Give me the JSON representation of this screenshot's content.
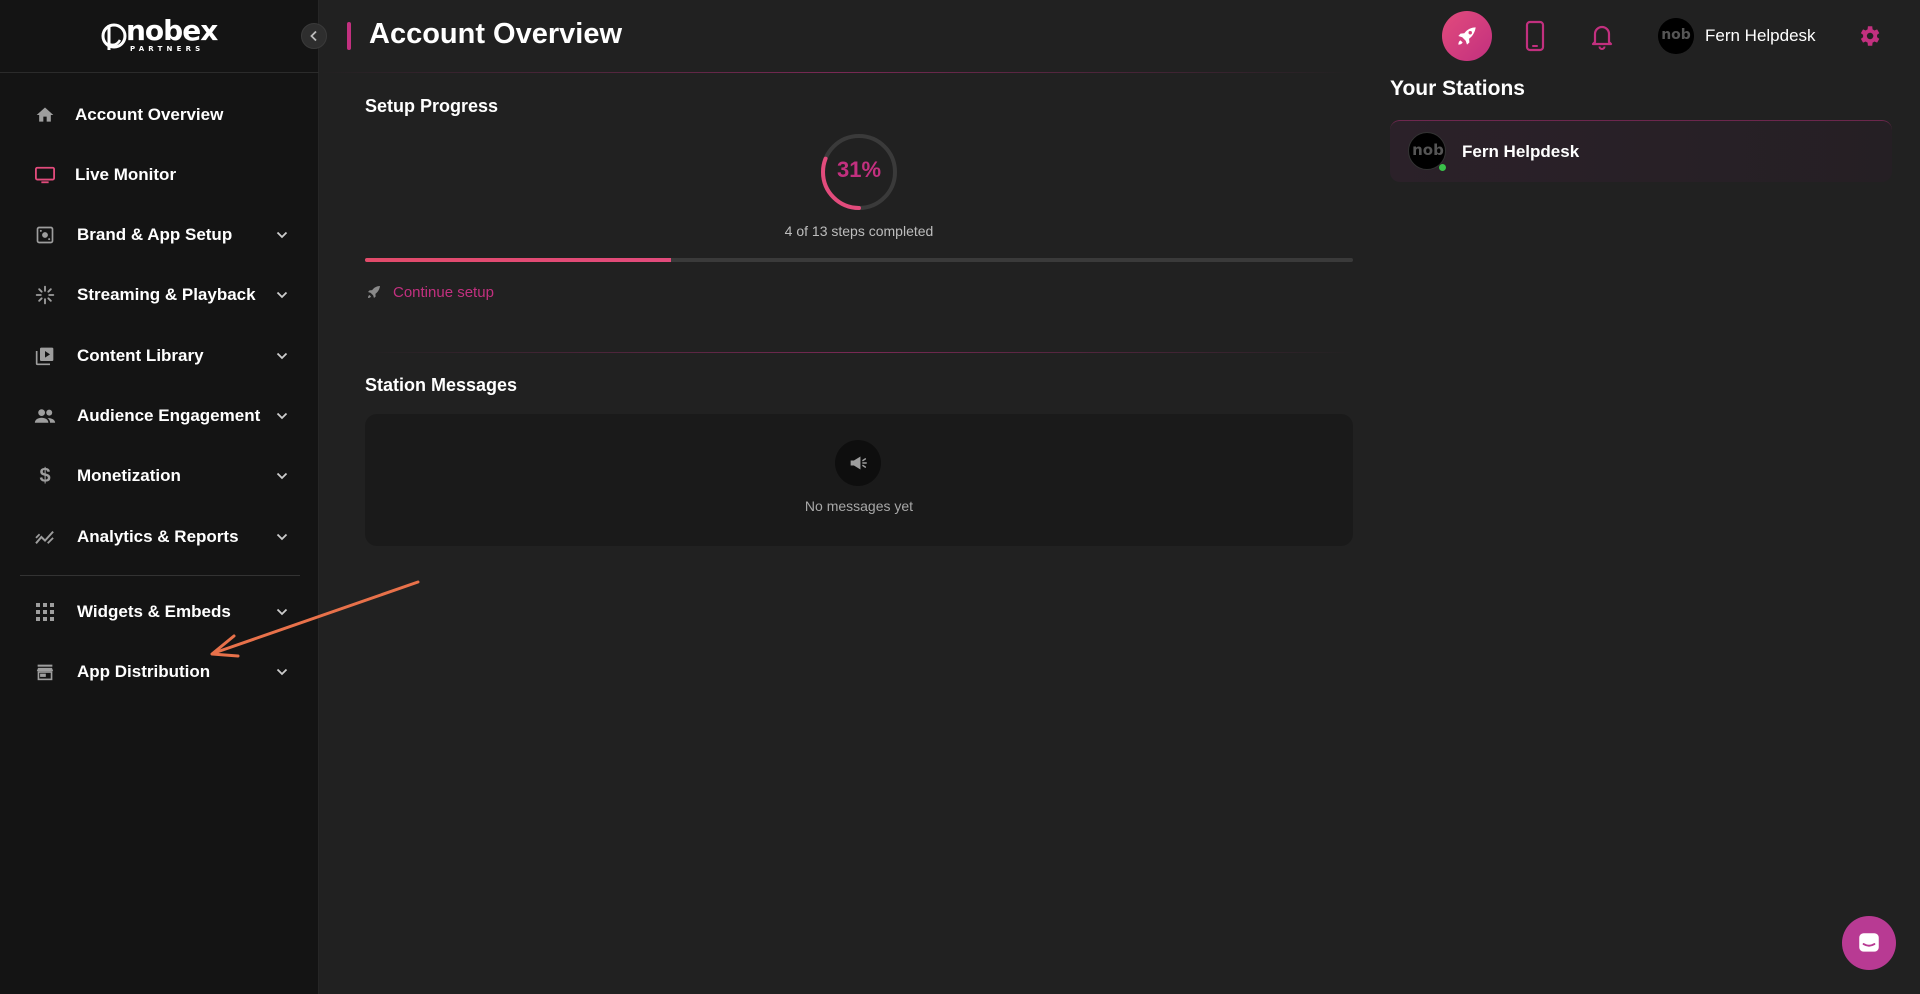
{
  "brand": {
    "name": "nobex",
    "subtitle": "PARTNERS",
    "accent_color": "#c2307f"
  },
  "sidebar": {
    "collapse_icon": "chevron-left-icon",
    "items": [
      {
        "label": "Account Overview",
        "icon": "home-icon",
        "expandable": false
      },
      {
        "label": "Live Monitor",
        "icon": "monitor-icon",
        "expandable": false
      },
      {
        "label": "Brand & App Setup",
        "icon": "brand-setup-icon",
        "expandable": true
      },
      {
        "label": "Streaming & Playback",
        "icon": "streaming-icon",
        "expandable": true
      },
      {
        "label": "Content Library",
        "icon": "video-library-icon",
        "expandable": true
      },
      {
        "label": "Audience Engagement",
        "icon": "people-icon",
        "expandable": true
      },
      {
        "label": "Monetization",
        "icon": "dollar-icon",
        "expandable": true
      },
      {
        "label": "Analytics & Reports",
        "icon": "chart-icon",
        "expandable": true
      },
      {
        "label": "Widgets & Embeds",
        "icon": "grid-icon",
        "expandable": true
      },
      {
        "label": "App Distribution",
        "icon": "store-icon",
        "expandable": true
      }
    ]
  },
  "header": {
    "title": "Account Overview",
    "user_name": "Fern Helpdesk",
    "avatar_text": "nob"
  },
  "setup_progress": {
    "title": "Setup Progress",
    "percent_label": "31%",
    "percent": 31,
    "steps_text": "4 of 13 steps completed",
    "bar_fill_fraction": 0.31,
    "continue_label": "Continue setup"
  },
  "station_messages": {
    "title": "Station Messages",
    "empty_text": "No messages yet"
  },
  "stations": {
    "title": "Your Stations",
    "items": [
      {
        "name": "Fern Helpdesk",
        "status": "online"
      }
    ]
  }
}
